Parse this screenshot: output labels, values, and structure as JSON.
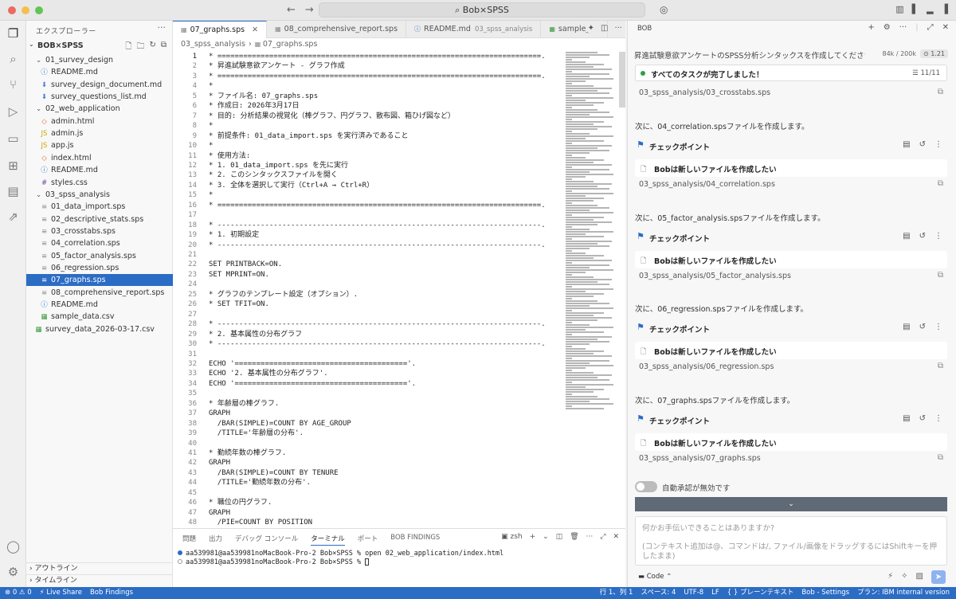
{
  "window": {
    "title": "Bob×SPSS",
    "traffic_colors": [
      "#ec6a5e",
      "#f4bf4f",
      "#61c554"
    ],
    "nav_back": "←",
    "nav_forward": "→"
  },
  "sidebar": {
    "title": "エクスプローラー",
    "root": "BOB×SPSS",
    "items": [
      {
        "label": "01_survey_design",
        "indent": 1,
        "type": "folder-open",
        "icon": "chevron-down-icon"
      },
      {
        "label": "README.md",
        "indent": 2,
        "type": "info",
        "icon": "info-icon"
      },
      {
        "label": "survey_design_document.md",
        "indent": 2,
        "type": "md",
        "icon": "markdown-icon"
      },
      {
        "label": "survey_questions_list.md",
        "indent": 2,
        "type": "md",
        "icon": "markdown-icon"
      },
      {
        "label": "02_web_application",
        "indent": 1,
        "type": "folder-open",
        "icon": "chevron-down-icon"
      },
      {
        "label": "admin.html",
        "indent": 2,
        "type": "html",
        "icon": "html-icon"
      },
      {
        "label": "admin.js",
        "indent": 2,
        "type": "js",
        "icon": "js-icon"
      },
      {
        "label": "app.js",
        "indent": 2,
        "type": "js",
        "icon": "js-icon"
      },
      {
        "label": "index.html",
        "indent": 2,
        "type": "html",
        "icon": "html-icon"
      },
      {
        "label": "README.md",
        "indent": 2,
        "type": "info",
        "icon": "info-icon"
      },
      {
        "label": "styles.css",
        "indent": 2,
        "type": "css",
        "icon": "css-icon"
      },
      {
        "label": "03_spss_analysis",
        "indent": 1,
        "type": "folder-open",
        "icon": "chevron-down-icon"
      },
      {
        "label": "01_data_import.sps",
        "indent": 2,
        "type": "sps",
        "icon": "file-icon"
      },
      {
        "label": "02_descriptive_stats.sps",
        "indent": 2,
        "type": "sps",
        "icon": "file-icon"
      },
      {
        "label": "03_crosstabs.sps",
        "indent": 2,
        "type": "sps",
        "icon": "file-icon"
      },
      {
        "label": "04_correlation.sps",
        "indent": 2,
        "type": "sps",
        "icon": "file-icon"
      },
      {
        "label": "05_factor_analysis.sps",
        "indent": 2,
        "type": "sps",
        "icon": "file-icon"
      },
      {
        "label": "06_regression.sps",
        "indent": 2,
        "type": "sps",
        "icon": "file-icon"
      },
      {
        "label": "07_graphs.sps",
        "indent": 2,
        "type": "sps",
        "icon": "file-icon",
        "selected": true
      },
      {
        "label": "08_comprehensive_report.sps",
        "indent": 2,
        "type": "sps",
        "icon": "file-icon"
      },
      {
        "label": "README.md",
        "indent": 2,
        "type": "info",
        "icon": "info-icon"
      },
      {
        "label": "sample_data.csv",
        "indent": 2,
        "type": "csv",
        "icon": "csv-icon"
      },
      {
        "label": "survey_data_2026-03-17.csv",
        "indent": 1,
        "type": "csv",
        "icon": "csv-icon"
      }
    ],
    "outline_label": "アウトライン",
    "timeline_label": "タイムライン"
  },
  "editor": {
    "tabs": [
      {
        "label": "07_graphs.sps",
        "active": true,
        "icon": "file-icon"
      },
      {
        "label": "08_comprehensive_report.sps",
        "active": false,
        "icon": "file-icon"
      },
      {
        "label": "README.md",
        "suffix": "03_spss_analysis",
        "active": false,
        "icon": "info-icon"
      },
      {
        "label": "sample_da",
        "active": false,
        "icon": "csv-icon"
      }
    ],
    "breadcrumb": [
      "03_spss_analysis",
      "07_graphs.sps"
    ],
    "lines": [
      "* ===========================================================================.",
      "* 昇進試験意欲アンケート - グラフ作成",
      "* ===========================================================================.",
      "*",
      "* ファイル名: 07_graphs.sps",
      "* 作成日: 2026年3月17日",
      "* 目的: 分析結果の視覚化（棒グラフ、円グラフ、散布図、箱ひげ図など）",
      "*",
      "* 前提条件: 01_data_import.sps を実行済みであること",
      "*",
      "* 使用方法:",
      "* 1. 01_data_import.sps を先に実行",
      "* 2. このシンタックスファイルを開く",
      "* 3. 全体を選択して実行（Ctrl+A → Ctrl+R）",
      "*",
      "* ===========================================================================.",
      "",
      "* ---------------------------------------------------------------------------.",
      "* 1. 初期設定",
      "* ---------------------------------------------------------------------------.",
      "",
      "SET PRINTBACK=ON.",
      "SET MPRINT=ON.",
      "",
      "* グラフのテンプレート設定（オプション）.",
      "* SET TFIT=ON.",
      "",
      "* ---------------------------------------------------------------------------.",
      "* 2. 基本属性の分布グラフ",
      "* ---------------------------------------------------------------------------.",
      "",
      "ECHO '========================================'.",
      "ECHO '2. 基本属性の分布グラフ'.",
      "ECHO '========================================'.",
      "",
      "* 年齢層の棒グラフ.",
      "GRAPH",
      "  /BAR(SIMPLE)=COUNT BY AGE_GROUP",
      "  /TITLE='年齢層の分布'.",
      "",
      "* 勤続年数の棒グラフ.",
      "GRAPH",
      "  /BAR(SIMPLE)=COUNT BY TENURE",
      "  /TITLE='勤続年数の分布'.",
      "",
      "* 職位の円グラフ.",
      "GRAPH",
      "  /PIE=COUNT BY POSITION"
    ]
  },
  "panel": {
    "tabs": [
      "問題",
      "出力",
      "デバッグ コンソール",
      "ターミナル",
      "ポート",
      "BOB FINDINGS"
    ],
    "active_tab": "ターミナル",
    "shell": "zsh",
    "terminal_lines": [
      "aa539981@aa539981noMacBook-Pro-2 Bob×SPSS % open 02_web_application/index.html",
      "aa539981@aa539981noMacBook-Pro-2 Bob×SPSS % "
    ],
    "prompt_colors": [
      "#2b6cc4",
      "#ffffff"
    ]
  },
  "chat": {
    "header": "BOB",
    "task_title": "昇進試験意欲アンケートのSPSS分析シンタックスを作成してください...",
    "tokens": "84k / 200k",
    "cost": "1.21",
    "task_done": "すべてのタスクが完了しました！",
    "task_count": "11/11",
    "top_file": "03_spss_analysis/03_crosstabs.sps",
    "entries": [
      {
        "message": "次に、04_correlation.spsファイルを作成します。",
        "checkpoint": "チェックポイント",
        "card": "Bobは新しいファイルを作成したい",
        "file": "03_spss_analysis/04_correlation.sps"
      },
      {
        "message": "次に、05_factor_analysis.spsファイルを作成します。",
        "checkpoint": "チェックポイント",
        "card": "Bobは新しいファイルを作成したい",
        "file": "03_spss_analysis/05_factor_analysis.sps"
      },
      {
        "message": "次に、06_regression.spsファイルを作成します。",
        "checkpoint": "チェックポイント",
        "card": "Bobは新しいファイルを作成したい",
        "file": "03_spss_analysis/06_regression.sps"
      },
      {
        "message": "次に、07_graphs.spsファイルを作成します。",
        "checkpoint": "チェックポイント",
        "card": "Bobは新しいファイルを作成したい",
        "file": "03_spss_analysis/07_graphs.sps"
      }
    ],
    "auto_approve": "自動承認が無効です",
    "input_placeholder": "何かお手伝いできることはありますか?",
    "input_hint": "(コンテキスト追加は@、コマンドは/, ファイル/画像をドラッグするにはShiftキーを押したまま)",
    "mode": "Code"
  },
  "statusbar": {
    "left": [
      "⊗ 0 ⚠ 0",
      "⚡ Live Share",
      "Bob Findings"
    ],
    "right": [
      "行 1、列 1",
      "スペース: 4",
      "UTF-8",
      "LF",
      "{ } プレーンテキスト",
      "Bob - Settings",
      "プラン: IBM internal version"
    ]
  }
}
